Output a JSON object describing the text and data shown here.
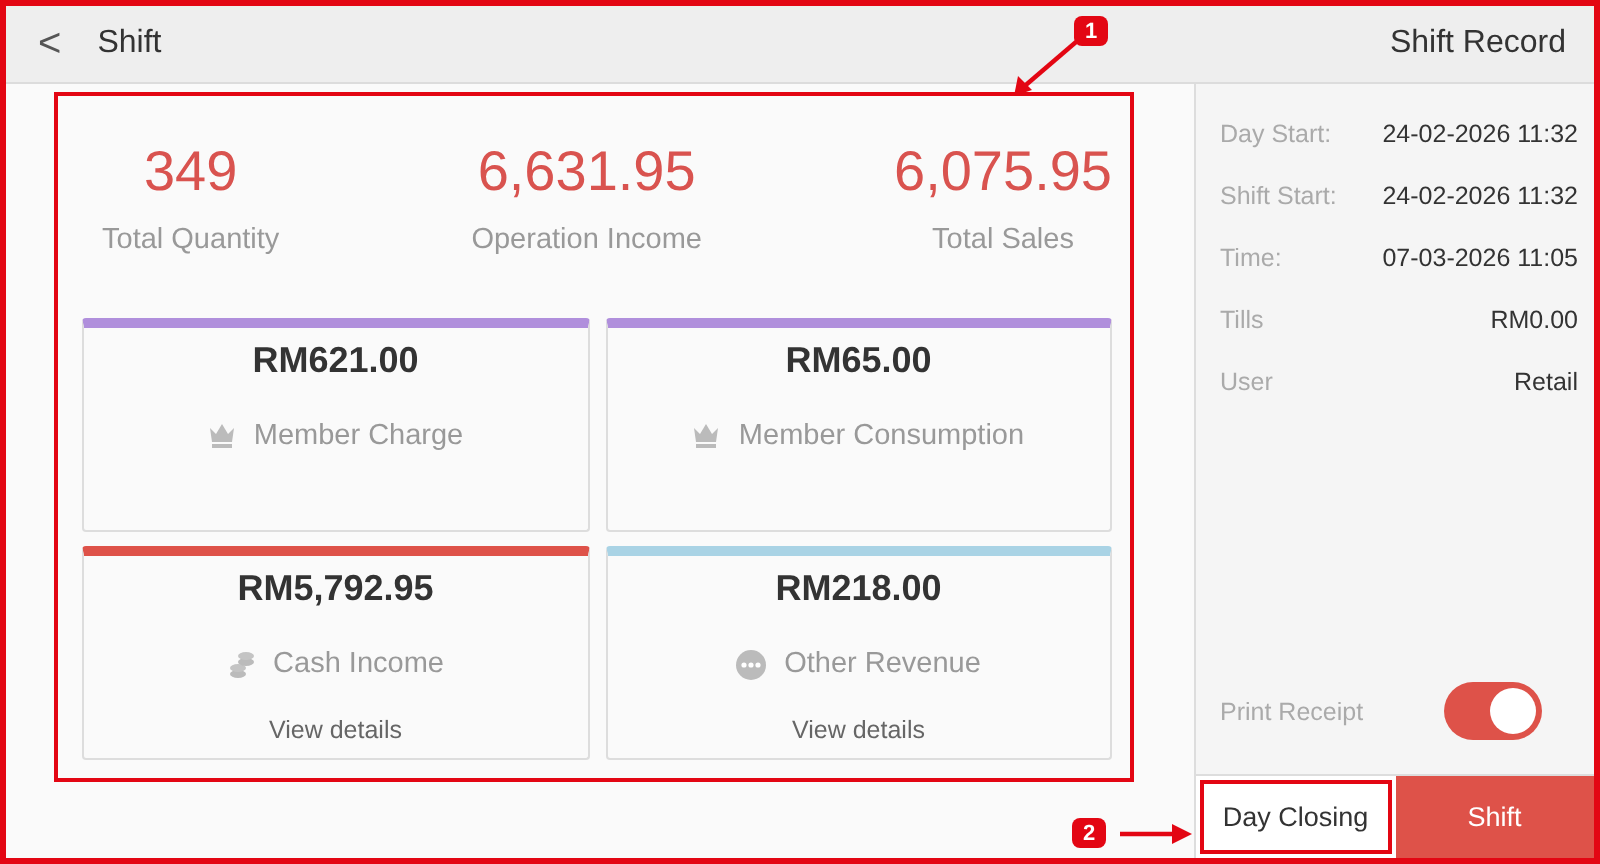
{
  "header": {
    "back": "<",
    "title": "Shift",
    "right_title": "Shift Record"
  },
  "stats": [
    {
      "value": "349",
      "label": "Total Quantity"
    },
    {
      "value": "6,631.95",
      "label": "Operation Income"
    },
    {
      "value": "6,075.95",
      "label": "Total Sales"
    }
  ],
  "cards": [
    {
      "amount": "RM621.00",
      "label": "Member Charge",
      "kind": "member",
      "color": "#b08fdc"
    },
    {
      "amount": "RM65.00",
      "label": "Member Consumption",
      "kind": "member",
      "color": "#b08fdc"
    },
    {
      "amount": "RM5,792.95",
      "label": "Cash Income",
      "kind": "cash",
      "color": "#de5249",
      "link": "View details"
    },
    {
      "amount": "RM218.00",
      "label": "Other Revenue",
      "kind": "other",
      "color": "#a9d3e5",
      "link": "View details"
    }
  ],
  "record": [
    {
      "label": "Day Start:",
      "value": "24-02-2026 11:32"
    },
    {
      "label": "Shift Start:",
      "value": "24-02-2026 11:32"
    },
    {
      "label": "Time:",
      "value": "07-03-2026 11:05"
    },
    {
      "label": "Tills",
      "value": "RM0.00"
    },
    {
      "label": "User",
      "value": "Retail"
    }
  ],
  "print_receipt": {
    "label": "Print Receipt",
    "on": true
  },
  "buttons": [
    {
      "label": "Day Closing",
      "kind": "plain"
    },
    {
      "label": "Shift",
      "kind": "primary"
    }
  ],
  "annotations": [
    {
      "label": "1"
    },
    {
      "label": "2"
    }
  ]
}
